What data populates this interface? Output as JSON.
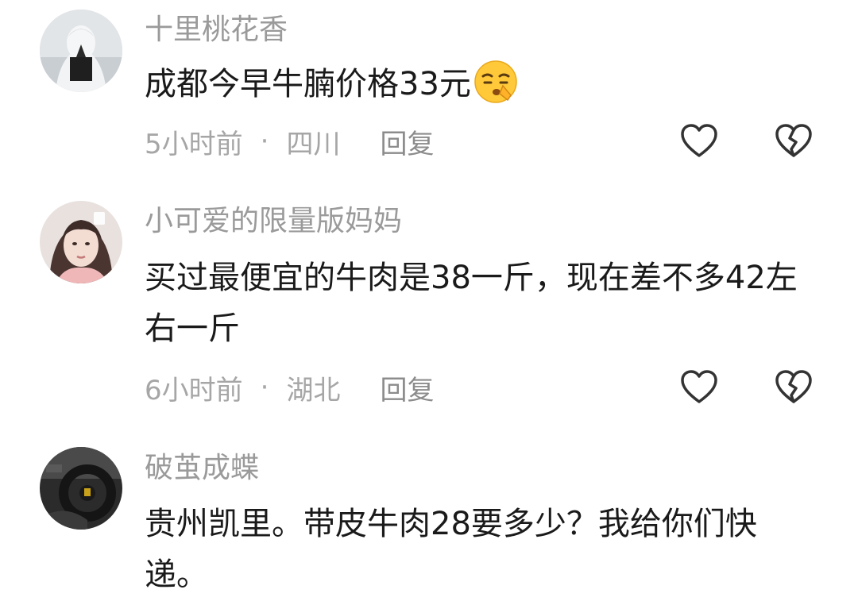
{
  "comments": [
    {
      "username": "十里桃花香",
      "text": "成都今早牛腩价格33元",
      "emoji": "shushing-face-emoji",
      "time": "5小时前",
      "separator": "·",
      "location": "四川",
      "reply_label": "回复"
    },
    {
      "username": "小可爱的限量版妈妈",
      "text": "买过最便宜的牛肉是38一斤，现在差不多42左右一斤",
      "time": "6小时前",
      "separator": "·",
      "location": "湖北",
      "reply_label": "回复"
    },
    {
      "username": "破茧成蝶",
      "text": "贵州凯里。带皮牛肉28要多少？我给你们快递。"
    }
  ],
  "icons": {
    "like": "heart-outline-icon",
    "dislike": "broken-heart-icon"
  },
  "colors": {
    "username": "#9a9a9a",
    "text": "#1a1a1a",
    "meta": "#a6a6a6",
    "icon": "#333333"
  }
}
